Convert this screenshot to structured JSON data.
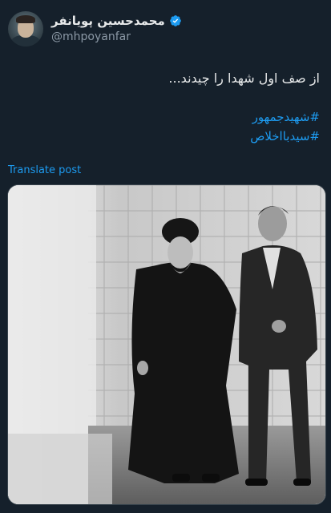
{
  "author": {
    "name": "محمدحسین پویانفر",
    "handle": "@mhpoyanfar",
    "verified_icon": "verified-badge-icon"
  },
  "tweet": {
    "text": "از صف اول شهدا را چیدند...",
    "hashtags": [
      "#شهیدجمهور",
      "#سیدبااخلاص"
    ],
    "translate_label": "Translate post"
  },
  "media": {
    "description": "black-and-white photo"
  },
  "colors": {
    "background": "#15202b",
    "link": "#1d9bf0",
    "secondary_text": "#8b98a5",
    "verified": "#1d9bf0"
  }
}
